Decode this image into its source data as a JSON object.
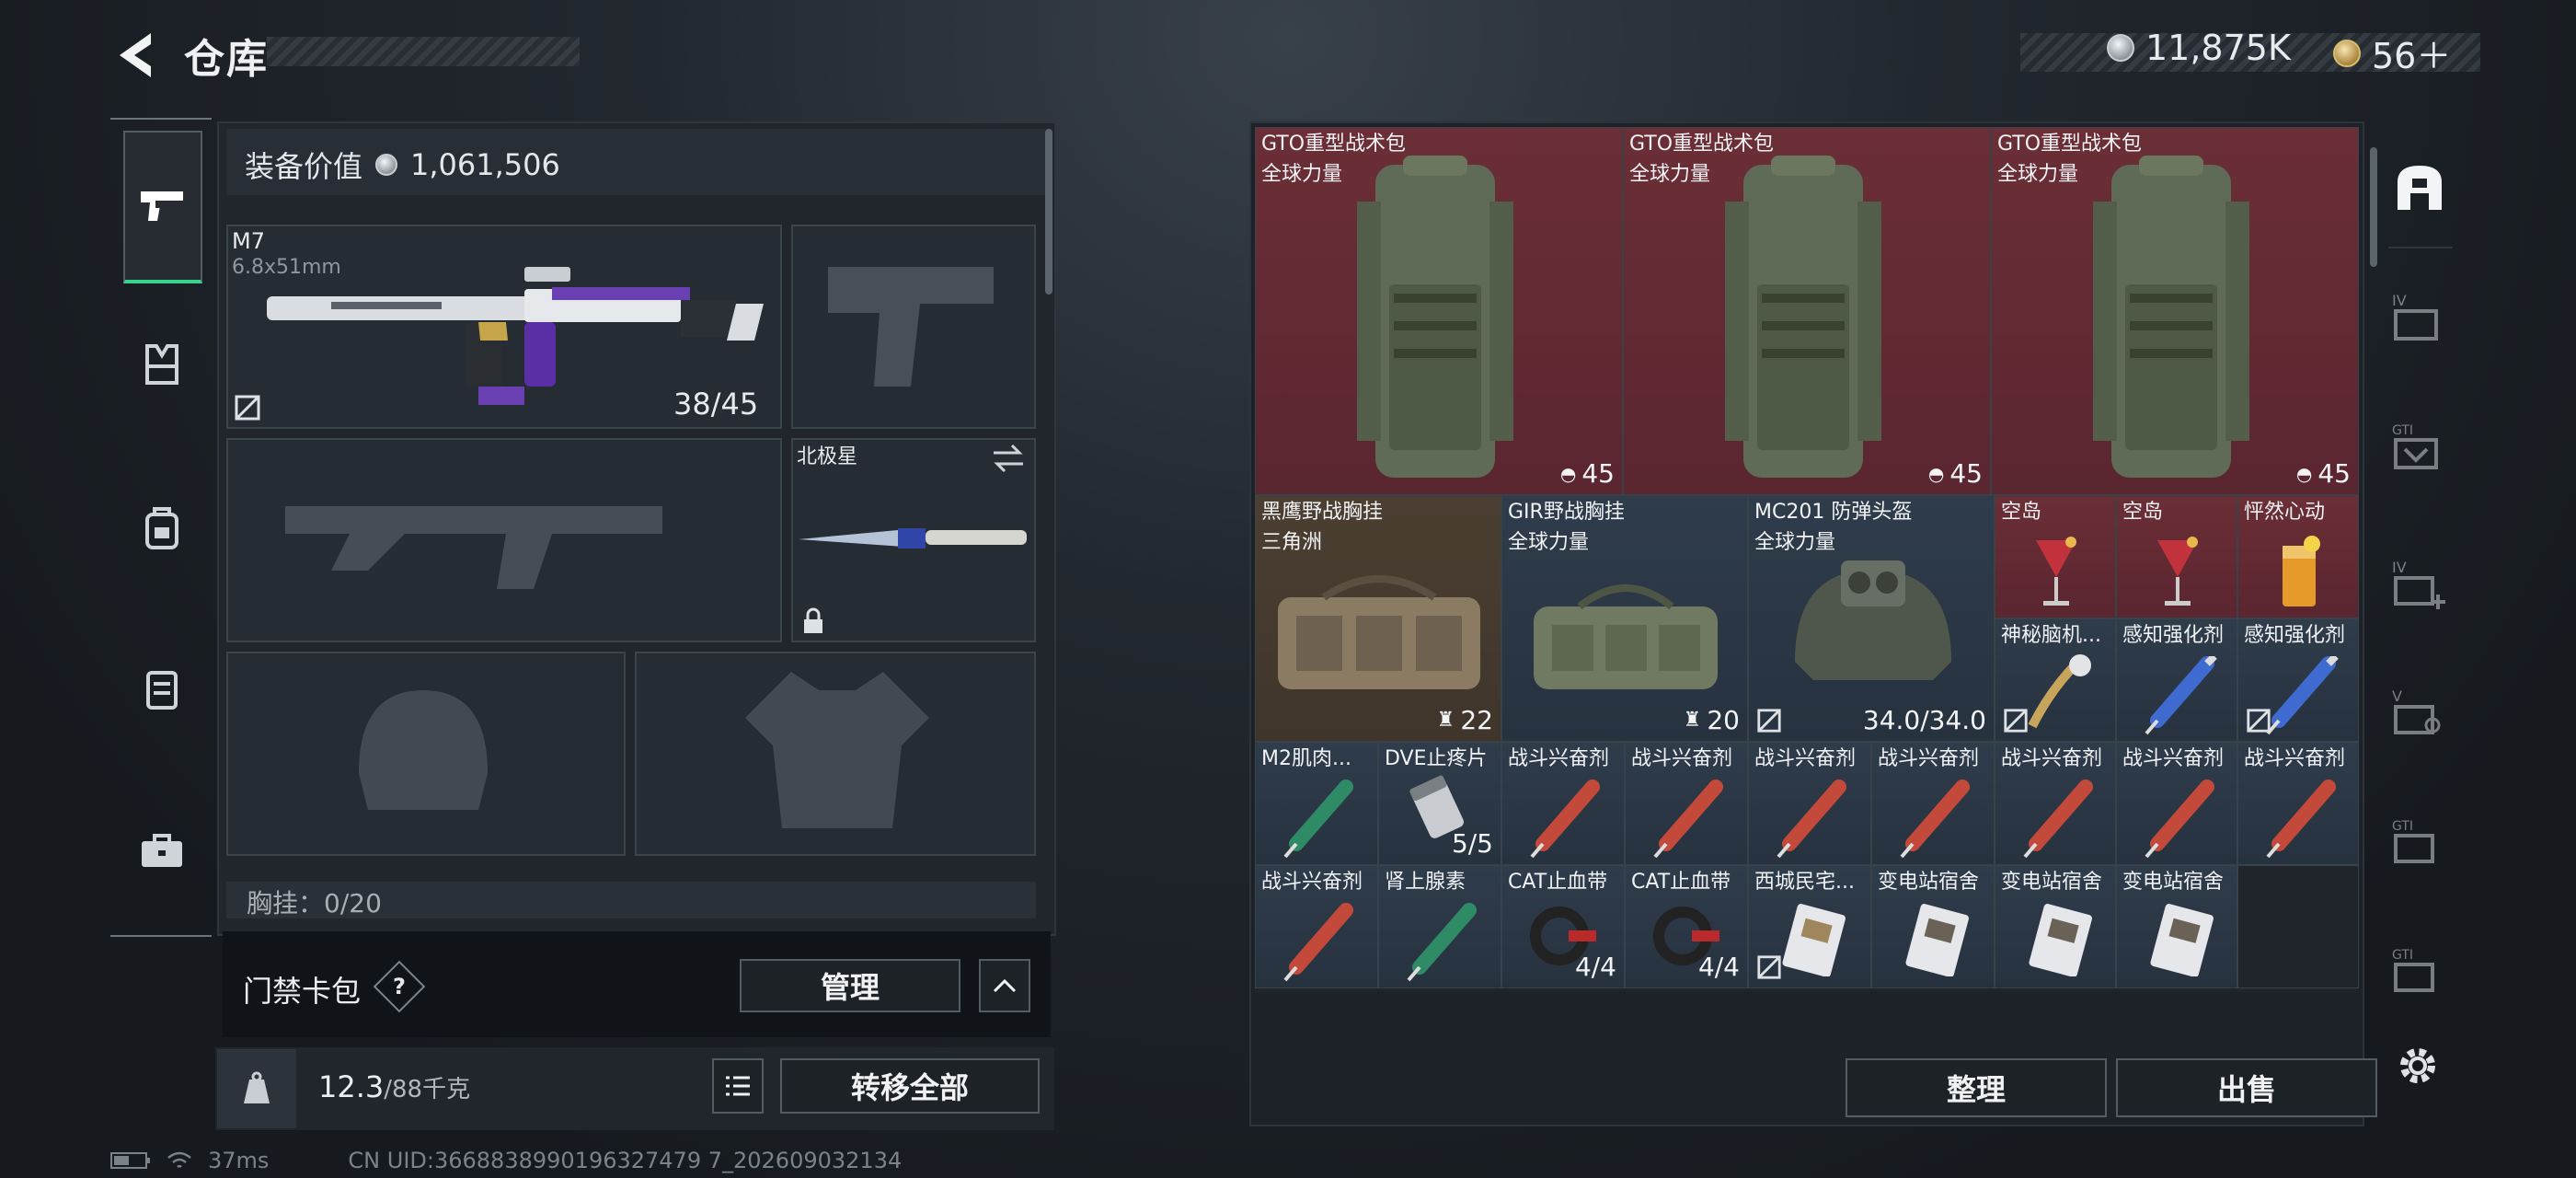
{
  "header": {
    "title": "仓库",
    "currency": {
      "silver": "11,875K",
      "gold": "56＋"
    }
  },
  "left": {
    "equip_value_label": "装备价值",
    "equip_value": "1,061,506",
    "primary": {
      "name": "M7",
      "caliber": "6.8x51mm",
      "ammo": "38/45"
    },
    "melee": {
      "name": "北极星"
    },
    "chest_rig_label": "胸挂：0/20",
    "cardpack": {
      "label": "门禁卡包",
      "help": "?",
      "manage": "管理"
    },
    "weight": {
      "value": "12.3",
      "max": "/88千克"
    },
    "transfer_all": "转移全部"
  },
  "status": {
    "ping": "37ms",
    "uid": "CN UID:3668838990196327479 7_202609032134"
  },
  "items": [
    {
      "name": "GTO重型战术包",
      "sub": "全球力量",
      "count": "45"
    },
    {
      "name": "GTO重型战术包",
      "sub": "全球力量",
      "count": "45"
    },
    {
      "name": "GTO重型战术包",
      "sub": "全球力量",
      "count": "45"
    },
    {
      "name": "黑鹰野战胸挂",
      "sub": "三角洲",
      "count": "22"
    },
    {
      "name": "GIR野战胸挂",
      "sub": "全球力量",
      "count": "20"
    },
    {
      "name": "MC201 防弹头盔",
      "sub": "全球力量",
      "count": "34.0/34.0"
    },
    {
      "name": "空岛"
    },
    {
      "name": "空岛"
    },
    {
      "name": "怦然心动"
    },
    {
      "name": "神秘脑机..."
    },
    {
      "name": "感知强化剂"
    },
    {
      "name": "感知强化剂"
    },
    {
      "name": "M2肌肉..."
    },
    {
      "name": "DVE止疼片",
      "count": "5/5"
    },
    {
      "name": "战斗兴奋剂"
    },
    {
      "name": "战斗兴奋剂"
    },
    {
      "name": "战斗兴奋剂"
    },
    {
      "name": "战斗兴奋剂"
    },
    {
      "name": "战斗兴奋剂"
    },
    {
      "name": "战斗兴奋剂"
    },
    {
      "name": "战斗兴奋剂"
    },
    {
      "name": "战斗兴奋剂"
    },
    {
      "name": "肾上腺素"
    },
    {
      "name": "CAT止血带",
      "count": "4/4"
    },
    {
      "name": "CAT止血带",
      "count": "4/4"
    },
    {
      "name": "西城民宅..."
    },
    {
      "name": "变电站宿舍"
    },
    {
      "name": "变电站宿舍"
    },
    {
      "name": "变电站宿舍"
    }
  ],
  "actions": {
    "sort": "整理",
    "sell": "出售"
  }
}
